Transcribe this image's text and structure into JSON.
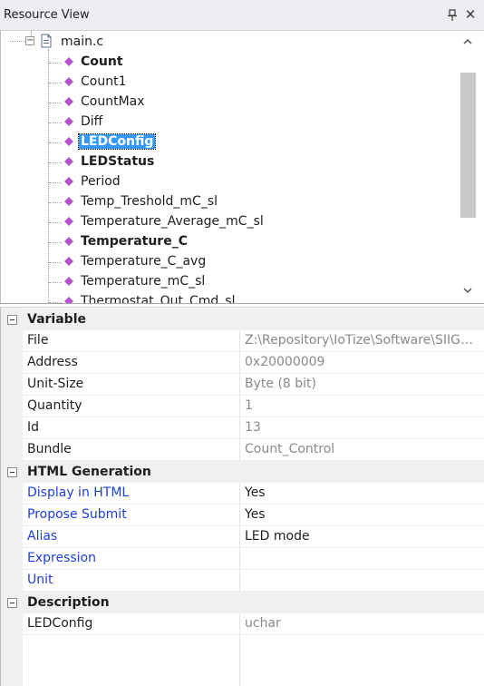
{
  "window": {
    "title": "Resource View",
    "icons": {
      "pin": "pin-icon",
      "close": "close-icon"
    }
  },
  "tree": {
    "file": {
      "label": "main.c",
      "icon": "file-icon",
      "expander": "⊟"
    },
    "items": [
      {
        "label": "Count",
        "bold": true,
        "selected": false
      },
      {
        "label": "Count1",
        "bold": false,
        "selected": false
      },
      {
        "label": "CountMax",
        "bold": false,
        "selected": false
      },
      {
        "label": "Diff",
        "bold": false,
        "selected": false
      },
      {
        "label": "LEDConfig",
        "bold": true,
        "selected": true
      },
      {
        "label": "LEDStatus",
        "bold": true,
        "selected": false
      },
      {
        "label": "Period",
        "bold": false,
        "selected": false
      },
      {
        "label": "Temp_Treshold_mC_sl",
        "bold": false,
        "selected": false
      },
      {
        "label": "Temperature_Average_mC_sl",
        "bold": false,
        "selected": false
      },
      {
        "label": "Temperature_C",
        "bold": true,
        "selected": false
      },
      {
        "label": "Temperature_C_avg",
        "bold": false,
        "selected": false
      },
      {
        "label": "Temperature_mC_sl",
        "bold": false,
        "selected": false
      },
      {
        "label": "Thermostat_Out_Cmd_sl",
        "bold": false,
        "selected": false
      }
    ],
    "item_icon": "variable-diamond-icon",
    "colors": {
      "diamond": "#b554c9",
      "selection": "#3399ff"
    }
  },
  "scrollbar": {
    "up": "˄",
    "down": "˅"
  },
  "properties": {
    "categories": [
      {
        "label": "Variable",
        "rows": [
          {
            "name": "File",
            "value": "Z:\\Repository\\IoTize\\Software\\SIIGe...",
            "editable": false
          },
          {
            "name": "Address",
            "value": "0x20000009",
            "editable": false
          },
          {
            "name": "Unit-Size",
            "value": "Byte (8 bit)",
            "editable": false
          },
          {
            "name": "Quantity",
            "value": "1",
            "editable": false
          },
          {
            "name": "Id",
            "value": "13",
            "editable": false
          },
          {
            "name": "Bundle",
            "value": "Count_Control",
            "editable": false
          }
        ]
      },
      {
        "label": "HTML Generation",
        "rows": [
          {
            "name": "Display in HTML",
            "value": "Yes",
            "editable": true
          },
          {
            "name": "Propose Submit",
            "value": "Yes",
            "editable": true
          },
          {
            "name": "Alias",
            "value": "LED mode",
            "editable": true
          },
          {
            "name": "Expression",
            "value": "",
            "editable": true
          },
          {
            "name": "Unit",
            "value": "",
            "editable": true
          }
        ]
      },
      {
        "label": "Description",
        "rows": [
          {
            "name": "LEDConfig",
            "value": "uchar",
            "editable": false
          }
        ]
      }
    ],
    "colors": {
      "editable_name": "#1f3fd6",
      "readonly_value": "#8a8a8a"
    }
  }
}
